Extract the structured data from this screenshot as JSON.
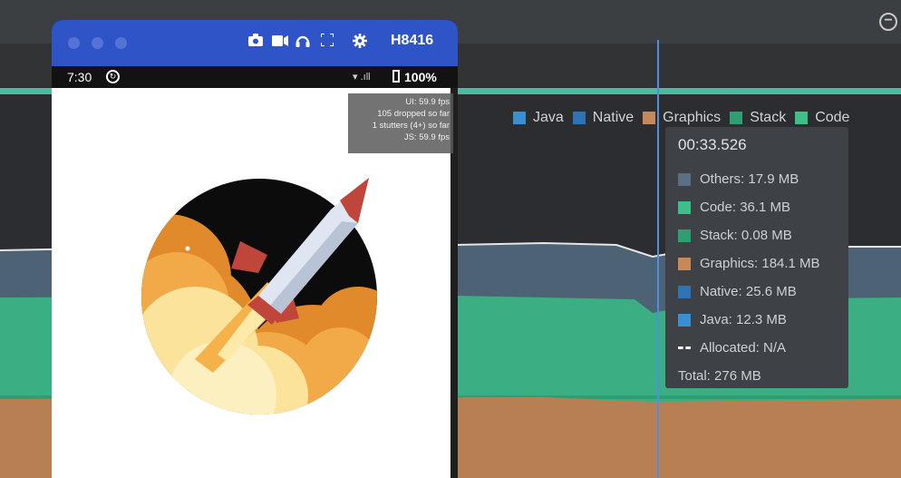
{
  "emulator": {
    "device_name": "H8416",
    "toolbar_icons": [
      "camera-icon",
      "video-record-icon",
      "headphones-icon",
      "fullscreen-icon",
      "gear-icon"
    ],
    "status_bar": {
      "time": "7:30",
      "battery": "100%"
    },
    "perf_overlay": {
      "ui_fps": "UI: 59.9 fps",
      "dropped": "105 dropped so far",
      "stutters": "1 stutters (4+) so far",
      "js_fps": "JS: 59.9 fps"
    }
  },
  "legend": [
    {
      "label": "Java",
      "color": "#3a8fd0"
    },
    {
      "label": "Native",
      "color": "#2e74b5"
    },
    {
      "label": "Graphics",
      "color": "#c8895a"
    },
    {
      "label": "Stack",
      "color": "#2f9e72"
    },
    {
      "label": "Code",
      "color": "#3cbf88"
    }
  ],
  "tooltip": {
    "time": "00:33.526",
    "rows": [
      {
        "label": "Others: 17.9 MB",
        "color": "#5a6f83"
      },
      {
        "label": "Code: 36.1 MB",
        "color": "#3cbf88"
      },
      {
        "label": "Stack: 0.08 MB",
        "color": "#2f9e72"
      },
      {
        "label": "Graphics: 184.1 MB",
        "color": "#c8895a"
      },
      {
        "label": "Native: 25.6 MB",
        "color": "#2e74b5"
      },
      {
        "label": "Java: 12.3 MB",
        "color": "#3a8fd0"
      }
    ],
    "allocated": "Allocated: N/A",
    "total": "Total: 276 MB"
  },
  "colors": {
    "toolbar": "#2f54c8",
    "others": "#5a6f83",
    "code": "#3cbf88",
    "graphics": "#c8895a",
    "cursor": "#4e8fe0"
  }
}
